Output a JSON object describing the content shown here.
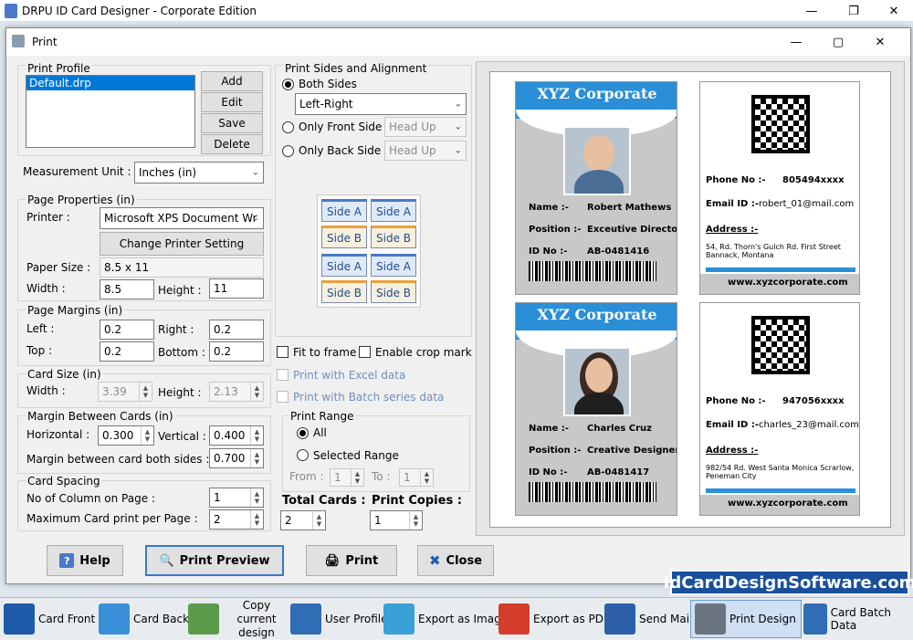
{
  "app": {
    "title": "DRPU ID Card Designer - Corporate Edition",
    "brand": "IdCardDesignSoftware.com"
  },
  "dialog": {
    "title": "Print"
  },
  "print_profile": {
    "legend": "Print Profile",
    "items": [
      "Default.drp"
    ],
    "add": "Add",
    "edit": "Edit",
    "save": "Save",
    "delete": "Delete"
  },
  "measurement": {
    "label": "Measurement Unit :",
    "value": "Inches (in)"
  },
  "page_props": {
    "legend": "Page Properties (in)",
    "printer_label": "Printer :",
    "printer_value": "Microsoft XPS Document Wr",
    "change_btn": "Change Printer Setting",
    "paper_label": "Paper Size :",
    "paper_value": "8.5 x 11",
    "width_label": "Width :",
    "width_value": "8.5",
    "height_label": "Height :",
    "height_value": "11"
  },
  "margins": {
    "legend": "Page Margins (in)",
    "left_label": "Left :",
    "left_value": "0.2",
    "right_label": "Right :",
    "right_value": "0.2",
    "top_label": "Top :",
    "top_value": "0.2",
    "bottom_label": "Bottom :",
    "bottom_value": "0.2"
  },
  "card_size": {
    "legend": "Card Size (in)",
    "width_label": "Width :",
    "width_value": "3.39",
    "height_label": "Height :",
    "height_value": "2.13"
  },
  "margin_between": {
    "legend": "Margin Between Cards (in)",
    "h_label": "Horizontal :",
    "h_value": "0.300",
    "v_label": "Vertical :",
    "v_value": "0.400",
    "both_label": "Margin between card both sides :",
    "both_value": "0.700"
  },
  "spacing": {
    "legend": "Card Spacing",
    "cols_label": "No of Column on Page :",
    "cols_value": "1",
    "max_label": "Maximum Card print per Page :",
    "max_value": "2"
  },
  "sides": {
    "legend": "Print Sides and Alignment",
    "both": "Both Sides",
    "both_align": "Left-Right",
    "front": "Only Front Side",
    "front_align": "Head Up",
    "back": "Only Back Side",
    "back_align": "Head Up",
    "side_a": "Side A",
    "side_b": "Side B"
  },
  "options": {
    "fit": "Fit to frame",
    "crop": "Enable crop mark",
    "excel": "Print with Excel data",
    "batch": "Print with Batch series data"
  },
  "range": {
    "legend": "Print Range",
    "all": "All",
    "selected": "Selected Range",
    "from_label": "From :",
    "from_value": "1",
    "to_label": "To :",
    "to_value": "1"
  },
  "totals": {
    "cards_label": "Total Cards :",
    "cards_value": "2",
    "copies_label": "Print Copies :",
    "copies_value": "1"
  },
  "buttons": {
    "help": "Help",
    "preview": "Print Preview",
    "print": "Print",
    "close": "Close"
  },
  "cards": [
    {
      "company": "XYZ Corporate",
      "name_label": "Name :-",
      "name": "Robert Mathews",
      "pos_label": "Position :-",
      "position": "Exceutive Director",
      "id_label": "ID No :-",
      "id": "AB-0481416",
      "phone_label": "Phone No :-",
      "phone": "805494xxxx",
      "email_label": "Email ID :-",
      "email": "robert_01@mail.com",
      "addr_label": "Address :-",
      "address": "54, Rd. Thorn's Gulch Rd. First Street Bannack, Montana",
      "web": "www.xyzcorporate.com"
    },
    {
      "company": "XYZ Corporate",
      "name_label": "Name :-",
      "name": "Charles Cruz",
      "pos_label": "Position :-",
      "position": "Creative Designer",
      "id_label": "ID No :-",
      "id": "AB-0481417",
      "phone_label": "Phone No :-",
      "phone": "947056xxxx",
      "email_label": "Email ID :-",
      "email": "charles_23@mail.com",
      "addr_label": "Address :-",
      "address": "982/54 Rd. West Santa Monica Scrarlow, Peneman City",
      "web": "www.xyzcorporate.com"
    }
  ],
  "taskbar": [
    "Card Front",
    "Card Back",
    "Copy current design",
    "User Profile",
    "Export as Image",
    "Export as PDF",
    "Send Mail",
    "Print Design",
    "Card Batch Data"
  ],
  "colors": {
    "accent": "#2a8fd6",
    "brand_bg": "#1a4f9c"
  }
}
